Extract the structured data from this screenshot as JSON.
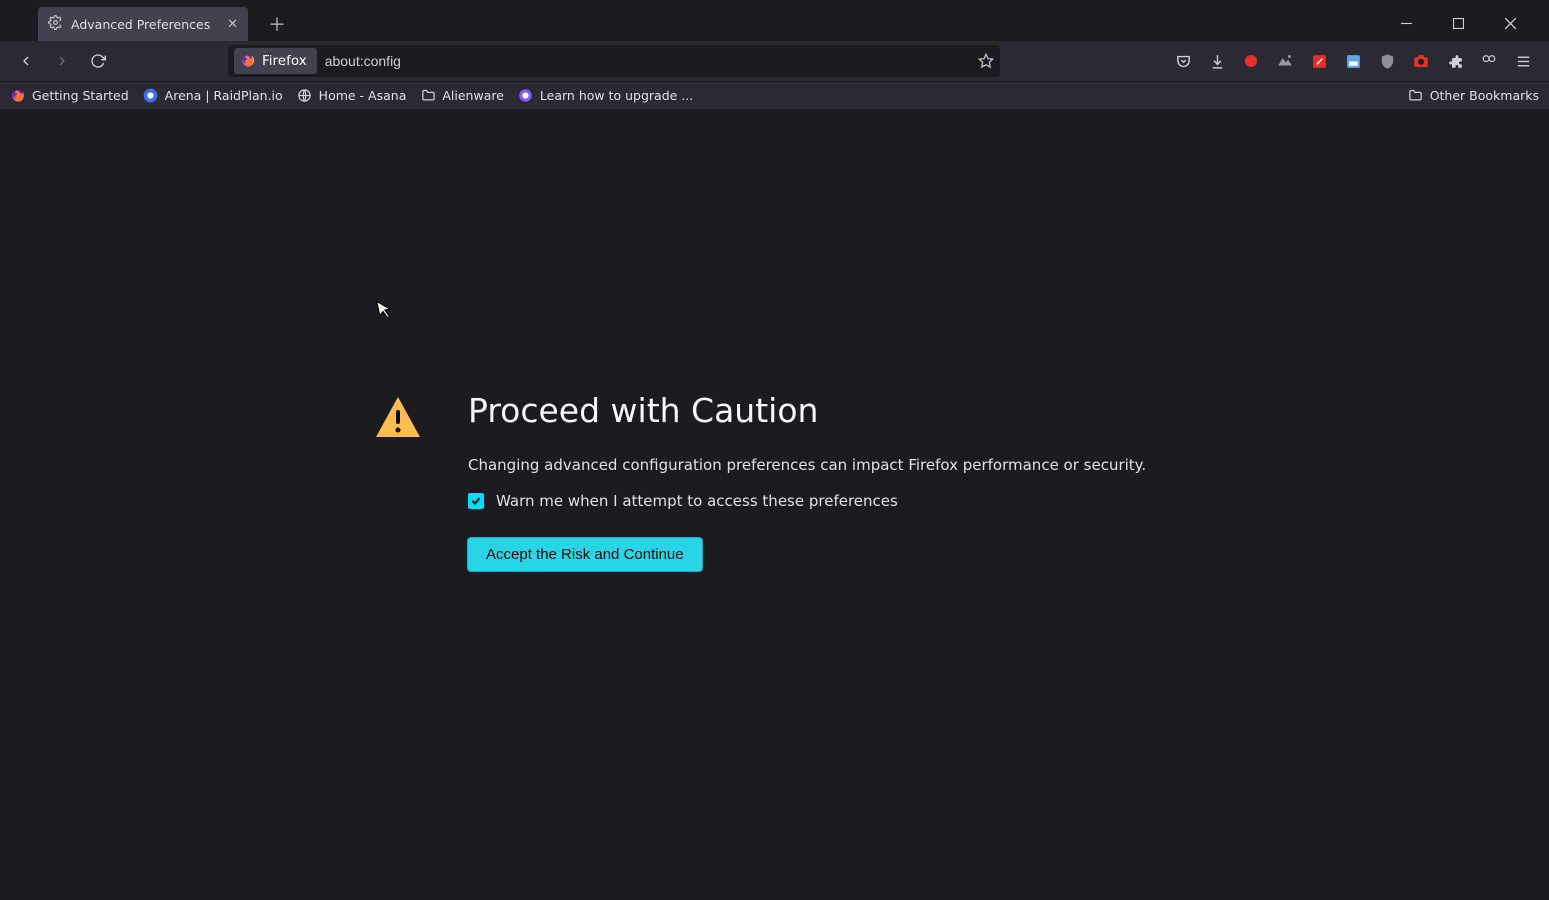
{
  "tab": {
    "title": "Advanced Preferences"
  },
  "urlbar": {
    "identity_label": "Firefox",
    "url": "about:config"
  },
  "bookmarks": {
    "items": [
      {
        "label": "Getting Started"
      },
      {
        "label": "Arena | RaidPlan.io"
      },
      {
        "label": "Home - Asana"
      },
      {
        "label": "Alienware"
      },
      {
        "label": "Learn how to upgrade ..."
      }
    ],
    "other_label": "Other Bookmarks"
  },
  "warning": {
    "title": "Proceed with Caution",
    "description": "Changing advanced configuration preferences can impact Firefox performance or security.",
    "checkbox_label": "Warn me when I attempt to access these preferences",
    "checkbox_checked": true,
    "button_label": "Accept the Risk and Continue"
  },
  "colors": {
    "accent": "#00ddff",
    "warning_icon": "#ffbd4f"
  }
}
